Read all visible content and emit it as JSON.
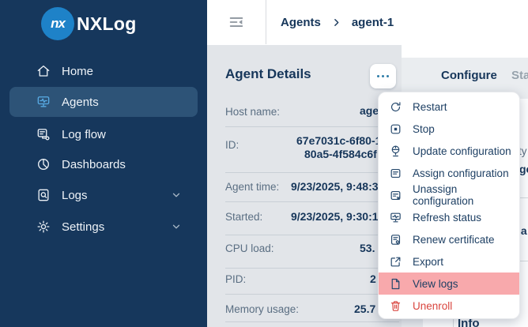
{
  "colors": {
    "sidebar_bg": "#16375c",
    "sidebar_active_bg": "#2d5377",
    "logo_blue": "#1e82c8",
    "active_icon_blue": "#58abe4",
    "heading_navy": "#16365a",
    "label_gray": "#5a6e82",
    "panel_gray": "#e2e5e9",
    "menu_highlight_pink": "#f8a9ac",
    "danger_red": "#d9453e",
    "ellipsis_dots": "#2f7da8"
  },
  "sidebar": {
    "logo": {
      "mark": "nx",
      "text": "NXLog"
    },
    "items": [
      {
        "label": "Home",
        "icon": "home-icon",
        "active": false,
        "expandable": false
      },
      {
        "label": "Agents",
        "icon": "agents-icon",
        "active": true,
        "expandable": false
      },
      {
        "label": "Log flow",
        "icon": "log-flow-icon",
        "active": false,
        "expandable": false
      },
      {
        "label": "Dashboards",
        "icon": "dashboards-icon",
        "active": false,
        "expandable": false
      },
      {
        "label": "Logs",
        "icon": "logs-icon",
        "active": false,
        "expandable": true
      },
      {
        "label": "Settings",
        "icon": "settings-icon",
        "active": false,
        "expandable": true
      }
    ]
  },
  "topbar": {
    "collapse_icon": "sidebar-collapse-icon",
    "breadcrumb": {
      "parent": "Agents",
      "current": "agent-1"
    }
  },
  "agent_details": {
    "title": "Agent Details",
    "more_button_icon": "ellipsis-icon",
    "fields": [
      {
        "label": "Host name:",
        "value": "age"
      },
      {
        "label": "ID:",
        "value": "67e7031c-6f80-1",
        "value_line2": "80a5-4f584c6f"
      },
      {
        "label": "Agent time:",
        "value": "9/23/2025, 9:48:3"
      },
      {
        "label": "Started:",
        "value": "9/23/2025, 9:30:1"
      },
      {
        "label": "CPU load:",
        "value": "53."
      },
      {
        "label": "PID:",
        "value": "2"
      },
      {
        "label": "Memory usage:",
        "value": "25.7"
      }
    ]
  },
  "tabs": {
    "configure": "Configure",
    "status_partial": "Sta"
  },
  "context_menu": {
    "items": [
      {
        "label": "Restart",
        "icon": "restart-icon"
      },
      {
        "label": "Stop",
        "icon": "stop-icon"
      },
      {
        "label": "Update configuration",
        "icon": "update-configuration-icon"
      },
      {
        "label": "Assign configuration",
        "icon": "assign-configuration-icon"
      },
      {
        "label": "Unassign configuration",
        "icon": "unassign-configuration-icon"
      },
      {
        "label": "Refresh status",
        "icon": "refresh-status-icon"
      },
      {
        "label": "Renew certificate",
        "icon": "renew-certificate-icon"
      },
      {
        "label": "Export",
        "icon": "export-icon"
      },
      {
        "label": "View logs",
        "icon": "view-logs-icon",
        "highlighted": true
      },
      {
        "label": "Unenroll",
        "icon": "unenroll-icon",
        "danger": true
      }
    ]
  },
  "right_panel": {
    "fragment_label": "ty",
    "fragment_value_1": "ge",
    "fragment_value_2": "la",
    "info_heading": "Info"
  }
}
